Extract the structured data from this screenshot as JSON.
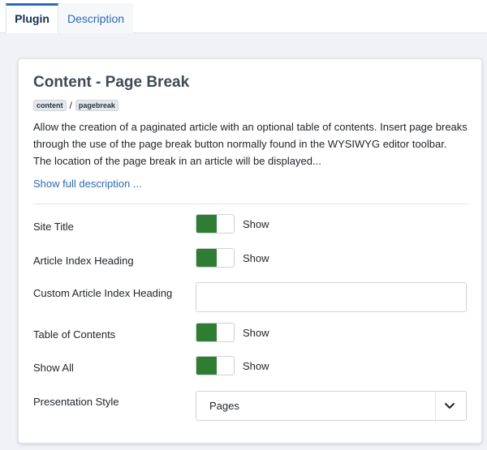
{
  "tabs": {
    "plugin": "Plugin",
    "description": "Description"
  },
  "card": {
    "title": "Content - Page Break",
    "badge_group": "content",
    "badge_element": "pagebreak",
    "separator": "/",
    "description": "Allow the creation of a paginated article with an optional table of contents. Insert page breaks through the use of the page break button normally found in the WYSIWYG editor toolbar. The location of the page break in an article will be displayed...",
    "show_full": "Show full description ..."
  },
  "fields": {
    "site_title": {
      "label": "Site Title",
      "state": "Show",
      "on": true
    },
    "article_index_heading": {
      "label": "Article Index Heading",
      "state": "Show",
      "on": true
    },
    "custom_article_index_heading": {
      "label": "Custom Article Index Heading",
      "value": ""
    },
    "table_of_contents": {
      "label": "Table of Contents",
      "state": "Show",
      "on": true
    },
    "show_all": {
      "label": "Show All",
      "state": "Show",
      "on": true
    },
    "presentation_style": {
      "label": "Presentation Style",
      "value": "Pages"
    }
  },
  "colors": {
    "accent": "#2a69b8",
    "toggle_on": "#2f7d32",
    "panel_bg": "#f0f2f5"
  }
}
